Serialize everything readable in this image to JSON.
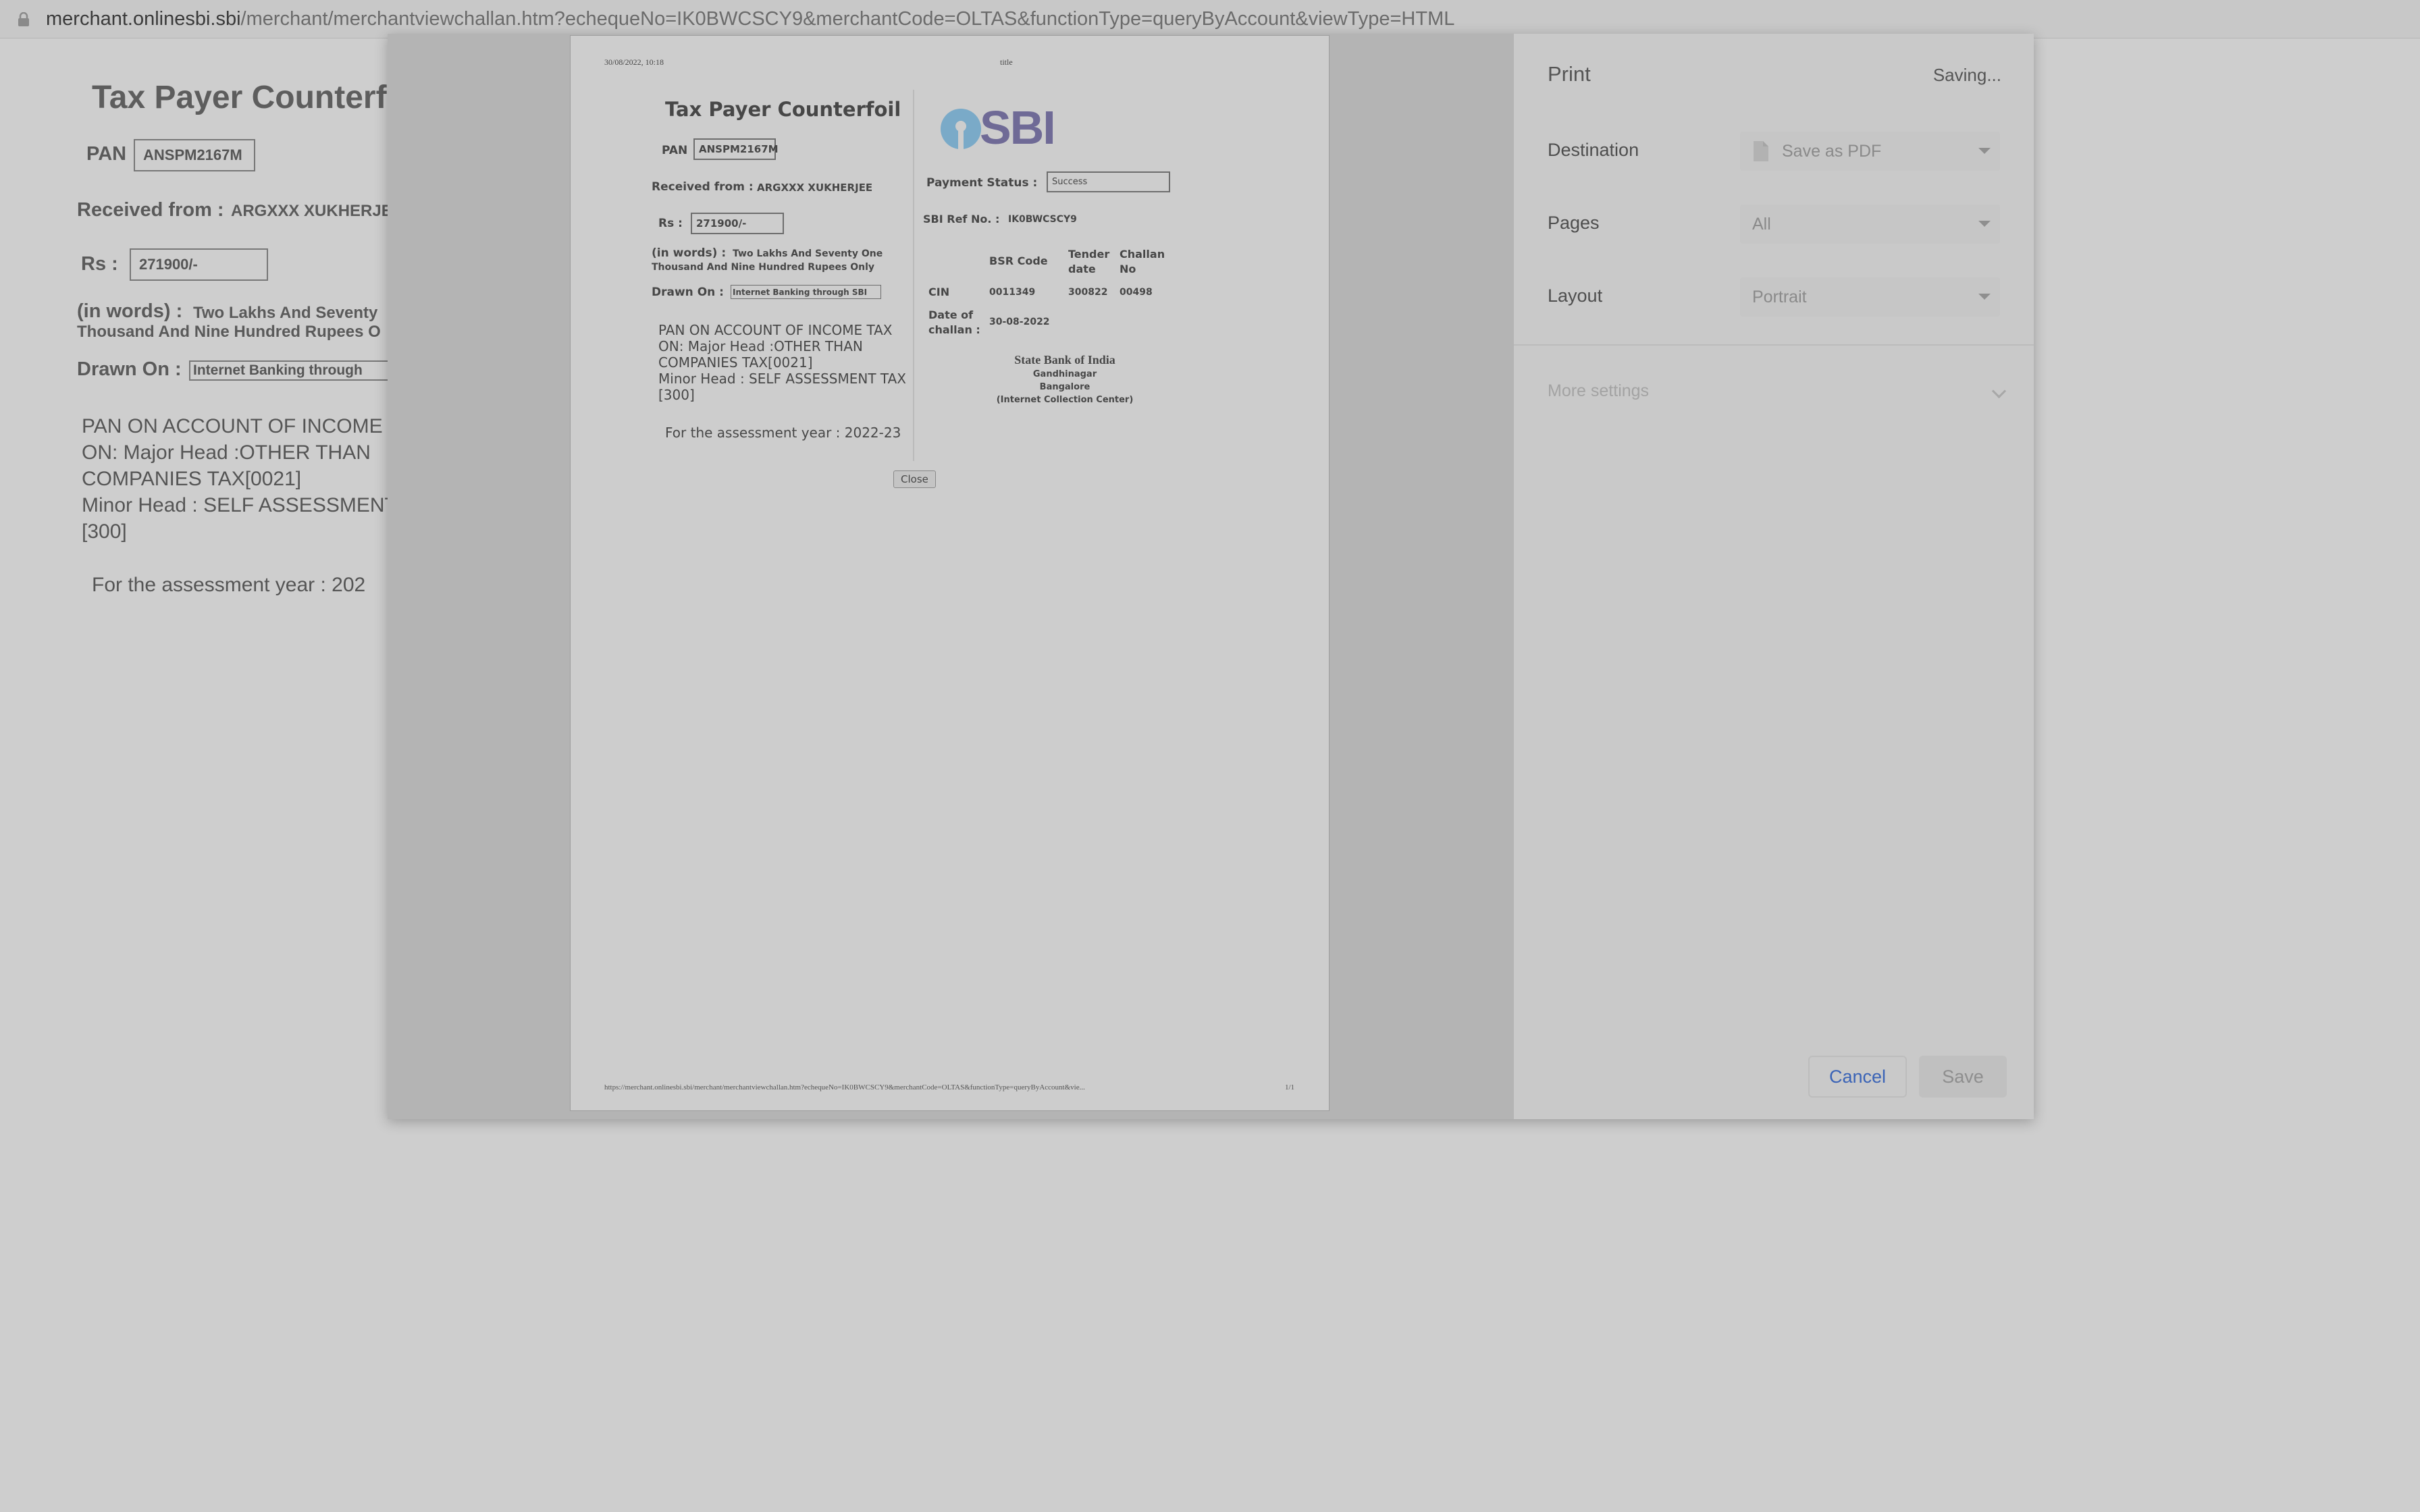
{
  "browser": {
    "url_host": "merchant.onlinesbi.sbi",
    "url_path": "/merchant/merchantviewchallan.htm?echequeNo=IK0BWCSCY9&merchantCode=OLTAS&functionType=queryByAccount&viewType=HTML"
  },
  "background_page": {
    "title": "Tax Payer Counterf",
    "pan_label": "PAN",
    "pan_value": "ANSPM2167M",
    "received_label": "Received from :",
    "received_value": "ARGXXX XUKHERJE",
    "rs_label": "Rs :",
    "rs_value": "271900/-",
    "words_label": "(in words) :",
    "words_line1": "Two Lakhs And Seventy",
    "words_line2": "Thousand And Nine Hundred Rupees O",
    "drawn_label": "Drawn On :",
    "drawn_value": "Internet Banking through",
    "account_line1": "PAN ON ACCOUNT OF INCOME",
    "account_line2": "ON: Major Head :OTHER THAN",
    "account_line3": "COMPANIES TAX[0021]",
    "account_line4": "Minor Head : SELF ASSESSMENT",
    "account_line5": "[300]",
    "assessment": "For the assessment year :  202"
  },
  "preview": {
    "header_date": "30/08/2022, 10:18",
    "header_title": "title",
    "title": "Tax Payer Counterfoil",
    "pan_label": "PAN",
    "pan_value": "ANSPM2167M",
    "received_label": "Received from :",
    "received_value": "ARGXXX XUKHERJEE",
    "rs_label": "Rs :",
    "rs_value": "271900/-",
    "words_label": "(in words) :",
    "words_line1": "Two Lakhs And Seventy One",
    "words_line2": "Thousand And Nine Hundred Rupees Only",
    "drawn_label": "Drawn On :",
    "drawn_value": "Internet Banking through SBI",
    "account_line1": "PAN ON ACCOUNT OF INCOME TAX",
    "account_line2": "ON: Major Head :OTHER THAN",
    "account_line3": "COMPANIES TAX[0021]",
    "account_line4": "Minor Head : SELF ASSESSMENT TAX",
    "account_line5": "[300]",
    "assessment": "For the assessment year :  2022-23",
    "logo_text": "SBI",
    "payment_status_label": "Payment Status :",
    "payment_status_value": "Success",
    "sbi_ref_label": "SBI Ref No. :",
    "sbi_ref_value": "IK0BWCSCY9",
    "col_bsr": "BSR Code",
    "col_tender_1": "Tender",
    "col_tender_2": "date",
    "col_challan_1": "Challan",
    "col_challan_2": "No",
    "cin_label": "CIN",
    "bsr_value": "0011349",
    "tender_value": "300822",
    "challan_value": "00498",
    "date_label_1": "Date of",
    "date_label_2": "challan :",
    "date_value": "30-08-2022",
    "bank_name": "State Bank of India",
    "branch": "Gandhinagar",
    "city": "Bangalore",
    "center": "(Internet Collection Center)",
    "close_label": "Close",
    "footer_url": "https://merchant.onlinesbi.sbi/merchant/merchantviewchallan.htm?echequeNo=IK0BWCSCY9&merchantCode=OLTAS&functionType=queryByAccount&vie...",
    "footer_page": "1/1"
  },
  "print_settings": {
    "title": "Print",
    "status": "Saving...",
    "destination_label": "Destination",
    "destination_value": "Save as PDF",
    "pages_label": "Pages",
    "pages_value": "All",
    "layout_label": "Layout",
    "layout_value": "Portrait",
    "more_settings": "More settings",
    "cancel": "Cancel",
    "save": "Save"
  },
  "colors": {
    "logo_blue": "#7aaac8",
    "logo_purple": "#6f6a96",
    "cancel_blue": "#3a63b6"
  }
}
